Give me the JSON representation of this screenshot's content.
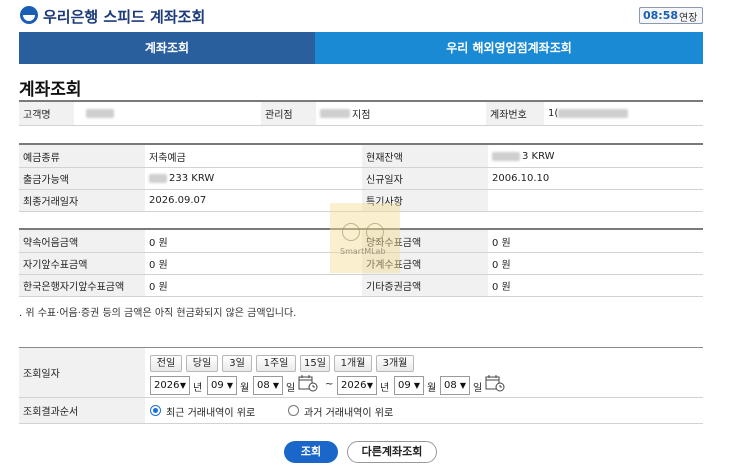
{
  "header": {
    "title": "우리은행 스피드 계좌조회",
    "time": "08:58",
    "extend_label": "연장"
  },
  "tabs": [
    {
      "label": "계좌조회",
      "active": true
    },
    {
      "label": "우리 해외영업점계좌조회",
      "active": false
    }
  ],
  "page_title": "계좌조회",
  "customer": {
    "name_label": "고객명",
    "branch_label": "관리점",
    "branch_suffix": "지점",
    "account_label": "계좌번호",
    "account_prefix": "1("
  },
  "details": {
    "type_label": "예금종류",
    "type_value": "저축예금",
    "balance_label": "현재잔액",
    "balance_value": "3 KRW",
    "withdraw_label": "출금가능액",
    "withdraw_value": "233 KRW",
    "opened_label": "신규일자",
    "opened_value": "2006.10.10",
    "last_tx_label": "최종거래일자",
    "last_tx_value": "2026.09.07",
    "special_label": "특기사항",
    "special_value": ""
  },
  "amounts": {
    "promissory_label": "약속어음금액",
    "promissory_value": "0 원",
    "bank_check_label": "당좌수표금액",
    "bank_check_value": "0 원",
    "own_check_label": "자기앞수표금액",
    "own_check_value": "0 원",
    "home_check_label": "가계수표금액",
    "home_check_value": "0 원",
    "bok_check_label": "한국은행자기앞수표금액",
    "bok_check_value": "0 원",
    "other_label": "기타증권금액",
    "other_value": "0 원"
  },
  "note": ". 위 수표·어음·증권 등의 금액은 아직 현금화되지 않은 금액입니다.",
  "query": {
    "date_label": "조회일자",
    "quick_buttons": [
      "전일",
      "당일",
      "3일",
      "1주일",
      "15일",
      "1개월",
      "3개월"
    ],
    "from": {
      "year": "2026",
      "month": "09",
      "day": "08"
    },
    "to": {
      "year": "2026",
      "month": "09",
      "day": "08"
    },
    "year_unit": "년",
    "month_unit": "월",
    "day_unit": "일",
    "range_sep": "~",
    "order_label": "조회결과순서",
    "order_options": [
      "최근 거래내역이 위로",
      "과거 거래내역이 위로"
    ],
    "order_selected": "최근 거래내역이 위로"
  },
  "actions": {
    "submit": "조회",
    "other_account": "다른계좌조회"
  },
  "watermark": "SmartMLab",
  "colors": {
    "tab_active": "#2a5f9e",
    "tab_other": "#1a8ad4",
    "primary_button": "#1b67c9"
  }
}
